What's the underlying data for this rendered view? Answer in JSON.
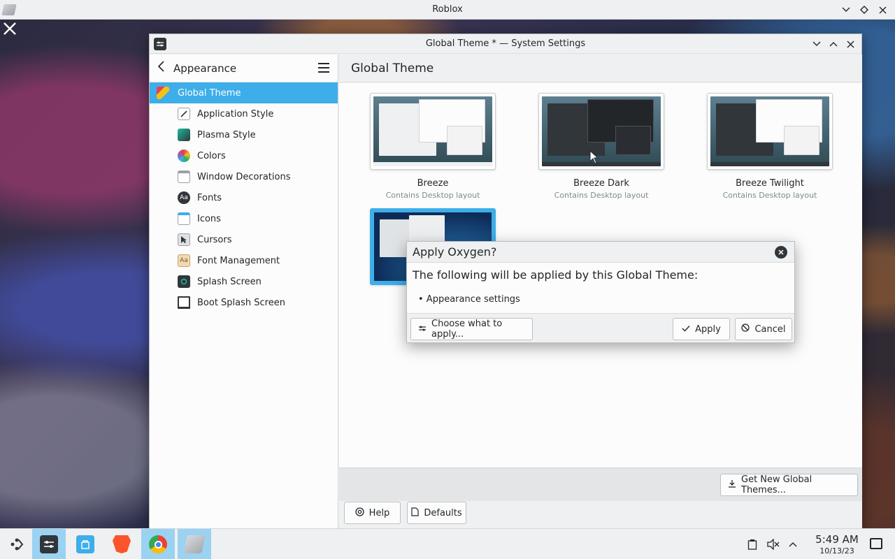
{
  "outer_window": {
    "title": "Roblox"
  },
  "window": {
    "title": "Global Theme * — System Settings"
  },
  "sidebar": {
    "header": "Appearance",
    "items": [
      {
        "label": "Global Theme",
        "icon": "global-theme-icon",
        "active": true
      },
      {
        "label": "Application Style",
        "icon": "application-style-icon"
      },
      {
        "label": "Plasma Style",
        "icon": "plasma-style-icon"
      },
      {
        "label": "Colors",
        "icon": "colors-icon"
      },
      {
        "label": "Window Decorations",
        "icon": "window-decorations-icon"
      },
      {
        "label": "Fonts",
        "icon": "fonts-icon"
      },
      {
        "label": "Icons",
        "icon": "icons-icon"
      },
      {
        "label": "Cursors",
        "icon": "cursors-icon"
      },
      {
        "label": "Font Management",
        "icon": "font-management-icon"
      },
      {
        "label": "Splash Screen",
        "icon": "splash-screen-icon"
      },
      {
        "label": "Boot Splash Screen",
        "icon": "boot-splash-screen-icon"
      }
    ]
  },
  "main": {
    "title": "Global Theme",
    "themes": [
      {
        "name": "Breeze",
        "subtitle": "Contains Desktop layout"
      },
      {
        "name": "Breeze Dark",
        "subtitle": "Contains Desktop layout"
      },
      {
        "name": "Breeze Twilight",
        "subtitle": "Contains Desktop layout"
      }
    ],
    "get_new_label": "Get New Global Themes...",
    "help_label": "Help",
    "defaults_label": "Defaults"
  },
  "dialog": {
    "title": "Apply Oxygen?",
    "heading": "The following will be applied by this Global Theme:",
    "bullet": "• Appearance settings",
    "choose_label": "Choose what to apply...",
    "apply_label": "Apply",
    "cancel_label": "Cancel"
  },
  "taskbar": {
    "time": "5:49 AM",
    "date": "10/13/23"
  },
  "colors": {
    "accent": "#3daee9",
    "window_bg": "#eff0f1",
    "view_bg": "#fcfcfc",
    "text": "#232629"
  }
}
